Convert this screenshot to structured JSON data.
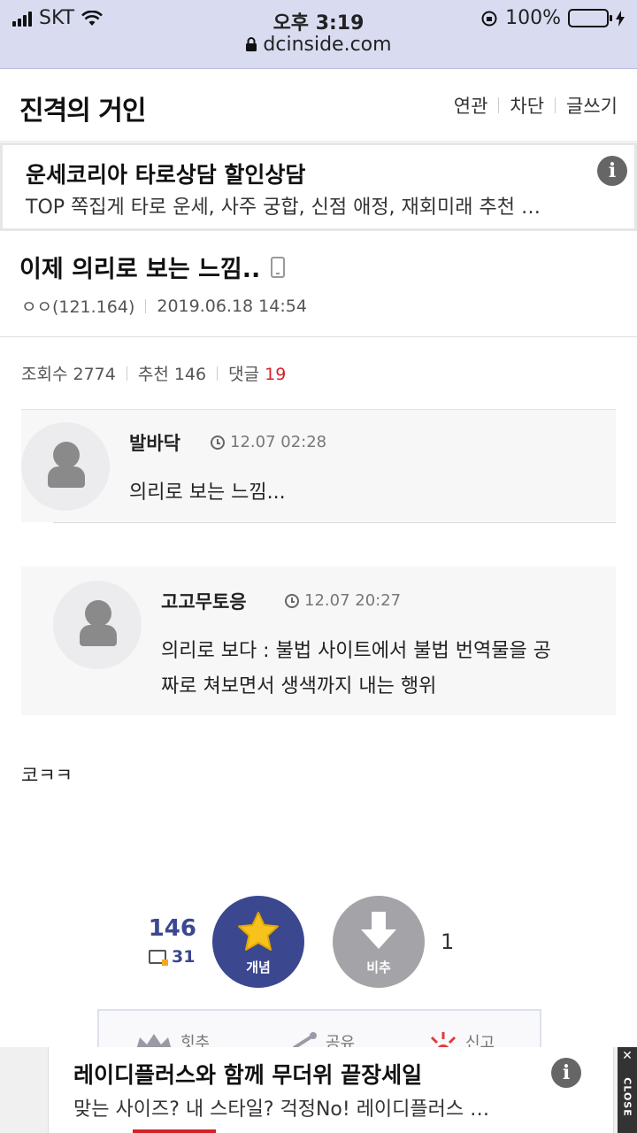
{
  "status_bar": {
    "carrier": "SKT",
    "time": "오후 3:19",
    "battery": "100%",
    "url": "dcinside.com"
  },
  "header": {
    "gallery_title": "진격의 거인",
    "links": [
      "연관",
      "차단",
      "글쓰기"
    ]
  },
  "ad_top": {
    "title": "운세코리아 타로상담 할인상담",
    "desc": "TOP 쪽집게 타로 운세, 사주 궁합, 신점 애정, 재회미래 추천 …"
  },
  "post": {
    "title": "이제 의리로 보는 느낌..",
    "author": "ㅇㅇ(121.164)",
    "date": "2019.06.18 14:54",
    "views_label": "조회수 2774",
    "recommend_label": "추천 146",
    "comments_label": "댓글",
    "comments_count": "19",
    "body": "코ㅋㅋ"
  },
  "quotes": [
    {
      "name": "발바닥",
      "time": "12.07 02:28",
      "text": "의리로 보는 느낌..."
    },
    {
      "name": "고고무토응",
      "time": "12.07 20:27",
      "line1": "의리로 보다 : 불법 사이트에서 불법 번역물을 공",
      "line2": "짜로 쳐보면서 생색까지 내는 행위"
    }
  ],
  "votes": {
    "up_count": "146",
    "fix_count": "31",
    "up_label": "개념",
    "down_label": "비추",
    "down_count": "1",
    "up_color": "#3b4890",
    "down_color": "#a3a3a8"
  },
  "actions": [
    "힛추",
    "공유",
    "신고"
  ],
  "ad_bottom": {
    "title": "레이디플러스와 함께 무더위 끝장세일",
    "desc": "맞는 사이즈? 내 스타일? 걱정No! 레이디플러스 …",
    "close_label": "CLOSE"
  }
}
